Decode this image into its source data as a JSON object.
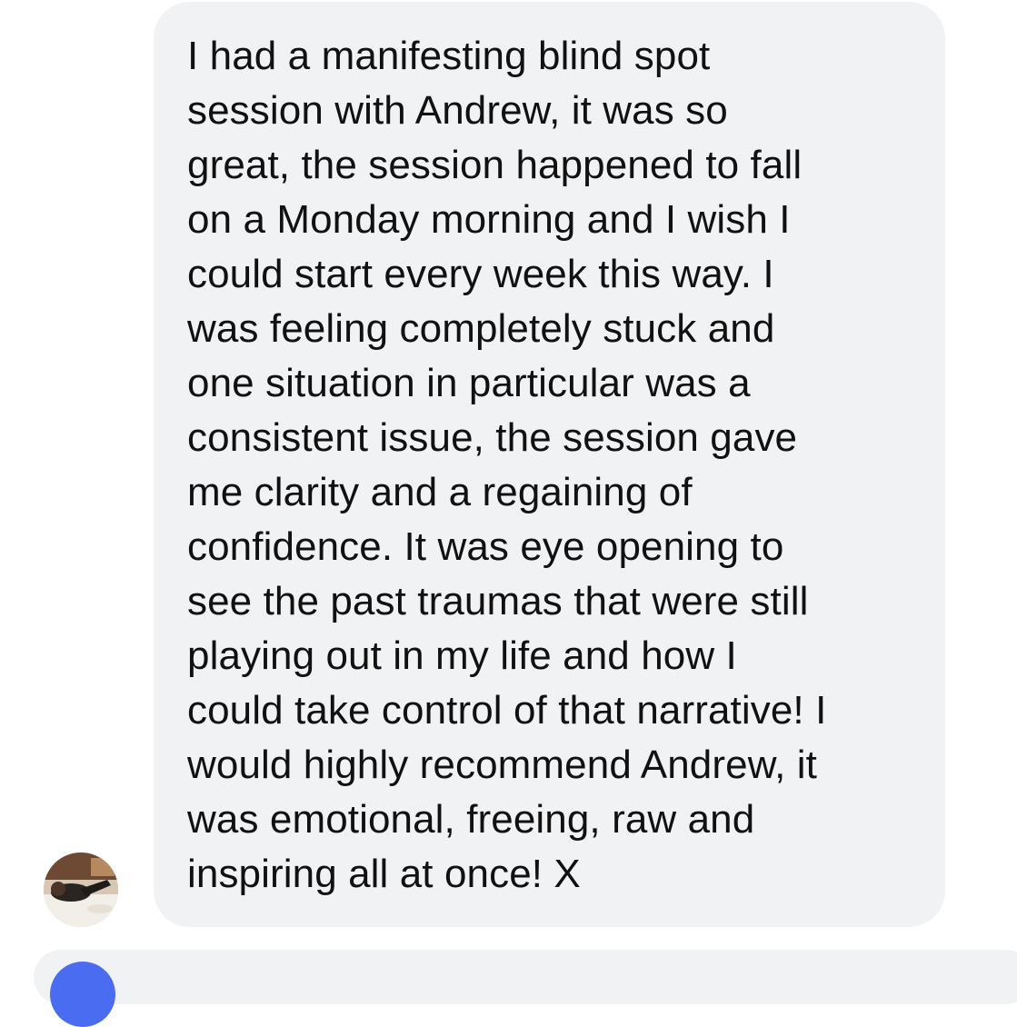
{
  "message": {
    "text": "I had a manifesting blind spot\nsession with Andrew, it was so\ngreat, the session happened to fall\non a Monday morning and I wish I\ncould start every week this way. I\nwas feeling completely stuck and\none situation in particular was a\nconsistent issue, the session gave\nme clarity and a regaining of\nconfidence. It was eye opening to\nsee the past traumas that were still\nplaying out in my life and how I\ncould take control of that narrative! I\nwould highly recommend Andrew, it\nwas emotional, freeing, raw and\ninspiring all at once! X",
    "avatar_icon": "avatar-photo-icon"
  },
  "colors": {
    "bubble": "#f1f2f4",
    "text": "#111111",
    "next_avatar": "#4a6cf0"
  }
}
